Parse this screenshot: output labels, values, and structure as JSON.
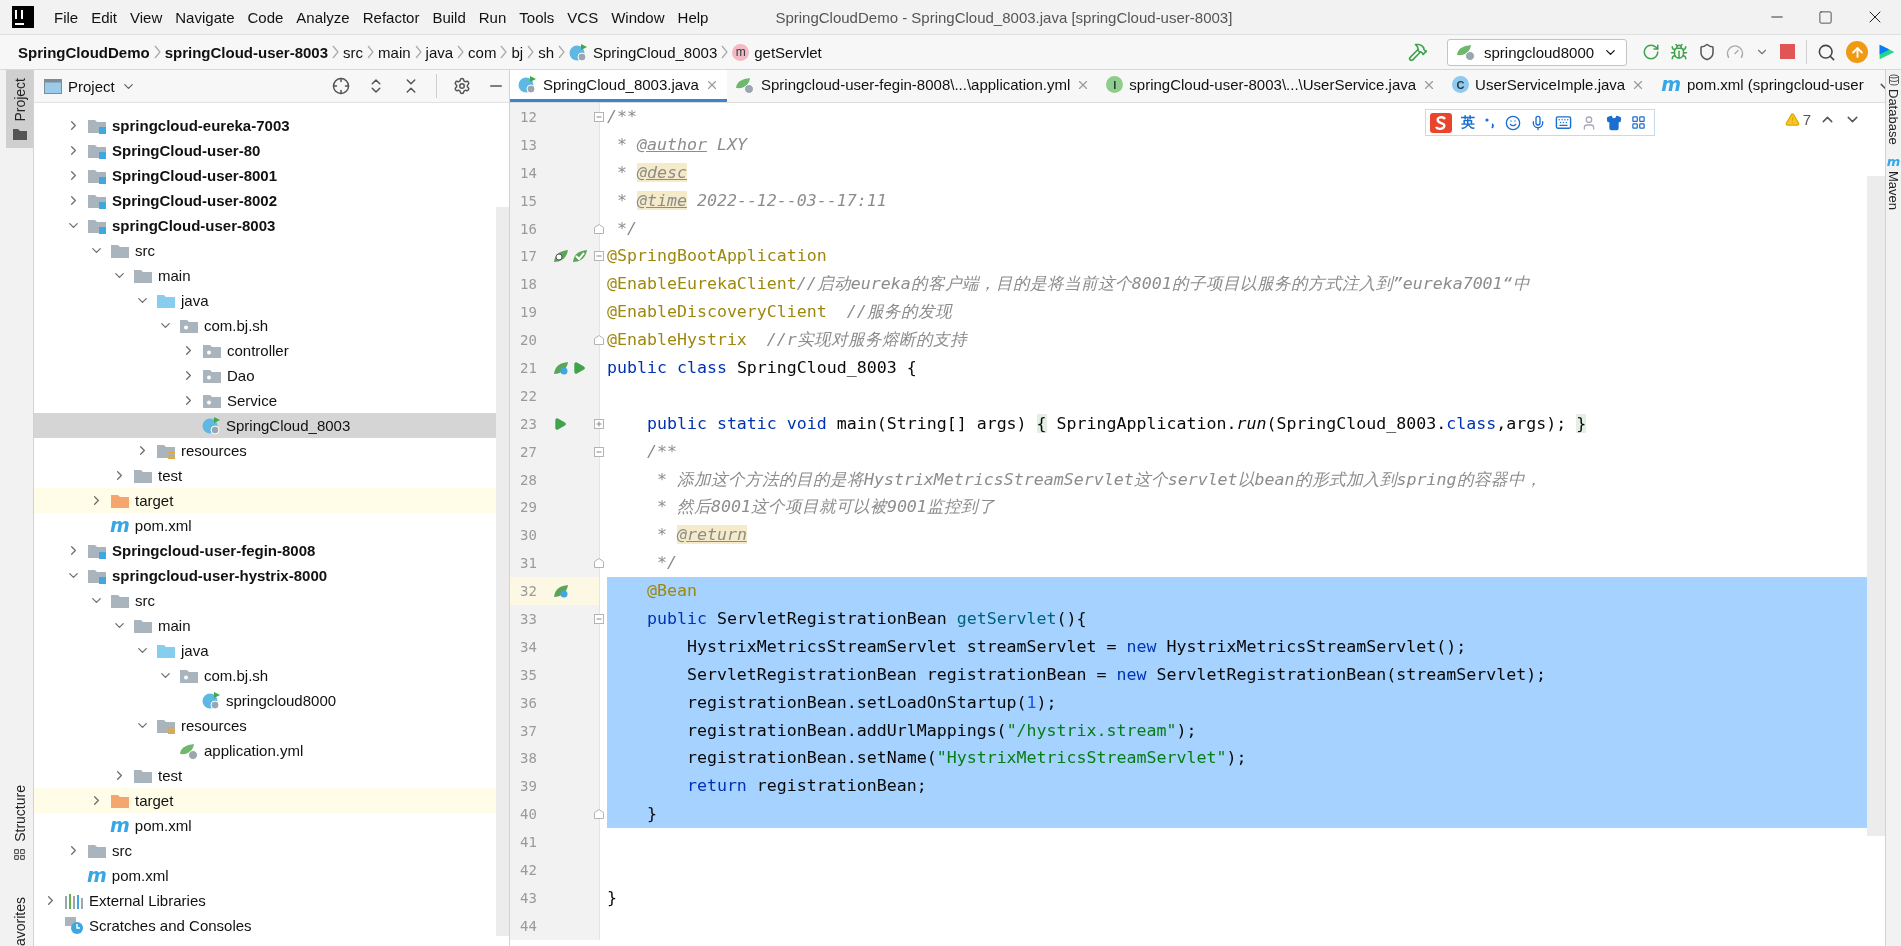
{
  "menu_bar": {
    "items": [
      "File",
      "Edit",
      "View",
      "Navigate",
      "Code",
      "Analyze",
      "Refactor",
      "Build",
      "Run",
      "Tools",
      "VCS",
      "Window",
      "Help"
    ],
    "title": "SpringCloudDemo - SpringCloud_8003.java [springCloud-user-8003]"
  },
  "breadcrumbs": [
    {
      "label": "SpringCloudDemo",
      "kind": "project"
    },
    {
      "label": "springCloud-user-8003",
      "kind": "module"
    },
    {
      "label": "src",
      "kind": "dir"
    },
    {
      "label": "main",
      "kind": "dir"
    },
    {
      "label": "java",
      "kind": "dir"
    },
    {
      "label": "com",
      "kind": "dir"
    },
    {
      "label": "bj",
      "kind": "dir"
    },
    {
      "label": "sh",
      "kind": "dir"
    },
    {
      "label": "SpringCloud_8003",
      "kind": "class"
    },
    {
      "label": "getServlet",
      "kind": "method",
      "badge": "m"
    }
  ],
  "toolbar": {
    "run_configuration": "springcloud8000"
  },
  "left_tool_tabs": [
    {
      "label": "Project",
      "selected": true
    },
    {
      "label": "Structure",
      "selected": false
    },
    {
      "label": "avorites",
      "selected": false
    }
  ],
  "project_panel": {
    "title": "Project",
    "items": [
      {
        "label": "springcloud-eureka-7003",
        "kind": "module",
        "expanded": false,
        "selected": false
      },
      {
        "label": "SpringCloud-user-80",
        "kind": "module",
        "expanded": false,
        "selected": false
      },
      {
        "label": "SpringCloud-user-8001",
        "kind": "module",
        "expanded": false,
        "selected": false
      },
      {
        "label": "SpringCloud-user-8002",
        "kind": "module",
        "expanded": false,
        "selected": false
      },
      {
        "label": "springCloud-user-8003",
        "kind": "module",
        "expanded": true,
        "selected": false,
        "children": [
          {
            "label": "src",
            "kind": "folder",
            "expanded": true,
            "selected": false,
            "children": [
              {
                "label": "main",
                "kind": "folder",
                "expanded": true,
                "selected": false,
                "children": [
                  {
                    "label": "java",
                    "kind": "source",
                    "expanded": true,
                    "selected": false,
                    "children": [
                      {
                        "label": "com.bj.sh",
                        "kind": "package",
                        "expanded": true,
                        "selected": false,
                        "children": [
                          {
                            "label": "controller",
                            "kind": "package",
                            "expanded": false,
                            "selected": false
                          },
                          {
                            "label": "Dao",
                            "kind": "package",
                            "expanded": false,
                            "selected": false
                          },
                          {
                            "label": "Service",
                            "kind": "package",
                            "expanded": false,
                            "selected": false
                          },
                          {
                            "label": "SpringCloud_8003",
                            "kind": "spring-class",
                            "selected": true
                          }
                        ]
                      }
                    ]
                  },
                  {
                    "label": "resources",
                    "kind": "resources",
                    "expanded": false,
                    "selected": false
                  }
                ]
              },
              {
                "label": "test",
                "kind": "folder",
                "expanded": false,
                "selected": false
              }
            ]
          },
          {
            "label": "target",
            "kind": "excluded",
            "expanded": false,
            "selected": false
          },
          {
            "label": "pom.xml",
            "kind": "maven",
            "badge": "m",
            "selected": false
          }
        ]
      },
      {
        "label": "Springcloud-user-fegin-8008",
        "kind": "module",
        "expanded": false,
        "selected": false
      },
      {
        "label": "springcloud-user-hystrix-8000",
        "kind": "module",
        "expanded": true,
        "selected": false,
        "children": [
          {
            "label": "src",
            "kind": "folder",
            "expanded": true,
            "selected": false,
            "children": [
              {
                "label": "main",
                "kind": "folder",
                "expanded": true,
                "selected": false,
                "children": [
                  {
                    "label": "java",
                    "kind": "source",
                    "expanded": true,
                    "selected": false,
                    "children": [
                      {
                        "label": "com.bj.sh",
                        "kind": "package",
                        "expanded": true,
                        "selected": false,
                        "children": [
                          {
                            "label": "springcloud8000",
                            "kind": "spring-class",
                            "selected": false
                          }
                        ]
                      }
                    ]
                  },
                  {
                    "label": "resources",
                    "kind": "resources",
                    "expanded": true,
                    "selected": false,
                    "children": [
                      {
                        "label": "application.yml",
                        "kind": "yml",
                        "selected": false
                      }
                    ]
                  }
                ]
              },
              {
                "label": "test",
                "kind": "folder",
                "expanded": false,
                "selected": false
              }
            ]
          },
          {
            "label": "target",
            "kind": "excluded",
            "expanded": false,
            "selected": false
          },
          {
            "label": "pom.xml",
            "kind": "maven",
            "badge": "m",
            "selected": false
          }
        ]
      },
      {
        "label": "src",
        "kind": "folder",
        "expanded": false,
        "selected": false
      },
      {
        "label": "pom.xml",
        "kind": "maven",
        "badge": "m",
        "selected": false
      }
    ],
    "root_items": [
      {
        "label": "External Libraries",
        "kind": "libraries",
        "expanded": false,
        "selected": false
      },
      {
        "label": "Scratches and Consoles",
        "kind": "scratches",
        "selected": false
      }
    ]
  },
  "editor_tabs": [
    {
      "label": "SpringCloud_8003.java",
      "kind": "spring-class",
      "selected": true,
      "closable": true
    },
    {
      "label": "Springcloud-user-fegin-8008\\...\\application.yml",
      "kind": "yml",
      "selected": false,
      "closable": true
    },
    {
      "label": "springCloud-user-8003\\...\\UserService.java",
      "kind": "interface",
      "badge": "I",
      "selected": false,
      "closable": true
    },
    {
      "label": "UserServiceImple.java",
      "kind": "class",
      "badge": "C",
      "selected": false,
      "closable": true
    },
    {
      "label": "pom.xml (springcloud-user",
      "kind": "maven",
      "badge": "m",
      "selected": false,
      "closable": false
    }
  ],
  "ime_toolbar": {
    "language": "英"
  },
  "inspections": {
    "warnings": "7"
  },
  "code_lines": [
    {
      "number": "12",
      "fold_marker": {
        "kind": "start"
      },
      "selected": false,
      "current": false,
      "tokens": [
        {
          "kind": "comment",
          "text": "/**"
        }
      ]
    },
    {
      "number": "13",
      "selected": false,
      "current": false,
      "tokens": [
        {
          "kind": "comment",
          "text": " * "
        },
        {
          "kind": "doctag",
          "text": "@author"
        },
        {
          "kind": "comment",
          "text": " LXY"
        }
      ]
    },
    {
      "number": "14",
      "selected": false,
      "current": false,
      "tokens": [
        {
          "kind": "comment",
          "text": " * "
        },
        {
          "kind": "doctag_marked",
          "text": "@desc"
        }
      ]
    },
    {
      "number": "15",
      "selected": false,
      "current": false,
      "tokens": [
        {
          "kind": "comment",
          "text": " * "
        },
        {
          "kind": "doctag_marked",
          "text": "@time"
        },
        {
          "kind": "comment",
          "text": " 2022--12--03--17:11"
        }
      ]
    },
    {
      "number": "16",
      "fold_marker": {
        "kind": "end"
      },
      "selected": false,
      "current": false,
      "tokens": [
        {
          "kind": "comment",
          "text": " */"
        }
      ]
    },
    {
      "number": "17",
      "fold_marker": {
        "kind": "start"
      },
      "selected": false,
      "current": false,
      "gutter": [
        {
          "kind": "bean-search"
        },
        {
          "kind": "bean-check"
        }
      ],
      "tokens": [
        {
          "kind": "annotation",
          "text": "@SpringBootApplication"
        }
      ]
    },
    {
      "number": "18",
      "selected": false,
      "current": false,
      "tokens": [
        {
          "kind": "annotation",
          "text": "@EnableEurekaClient"
        },
        {
          "kind": "comment",
          "text": "//启动eureka的客户端，目的是将当前这个8001的子项目以服务的方式注入到”eureka7001“中"
        }
      ]
    },
    {
      "number": "19",
      "selected": false,
      "current": false,
      "tokens": [
        {
          "kind": "annotation",
          "text": "@EnableDiscoveryClient"
        },
        {
          "kind": "comment",
          "text": "  //服务的发现"
        }
      ]
    },
    {
      "number": "20",
      "fold_marker": {
        "kind": "end"
      },
      "selected": false,
      "current": false,
      "tokens": [
        {
          "kind": "annotation",
          "text": "@EnableHystrix"
        },
        {
          "kind": "comment",
          "text": "  //r实现对服务熔断的支持"
        }
      ]
    },
    {
      "number": "21",
      "selected": false,
      "current": false,
      "gutter": [
        {
          "kind": "bean"
        },
        {
          "kind": "run"
        }
      ],
      "tokens": [
        {
          "kind": "keyword",
          "text": "public class"
        },
        {
          "kind": "plain",
          "text": " SpringCloud_8003 {"
        }
      ]
    },
    {
      "number": "22",
      "selected": false,
      "current": false
    },
    {
      "number": "23",
      "fold_marker": {
        "kind": "collapsed"
      },
      "selected": false,
      "current": false,
      "gutter": [
        {
          "kind": "run"
        }
      ],
      "tokens": [
        {
          "kind": "keyword",
          "text": "    public static void"
        },
        {
          "kind": "plain",
          "text": " main(String[] args) "
        },
        {
          "kind": "folded",
          "text": "{"
        },
        {
          "kind": "plain",
          "text": " SpringApplication."
        },
        {
          "kind": "static_call",
          "text": "run"
        },
        {
          "kind": "plain",
          "text": "(SpringCloud_8003."
        },
        {
          "kind": "keyword",
          "text": "class"
        },
        {
          "kind": "plain",
          "text": ",args); "
        },
        {
          "kind": "folded",
          "text": "}"
        }
      ]
    },
    {
      "number": "27",
      "fold_marker": {
        "kind": "start"
      },
      "selected": false,
      "current": false,
      "tokens": [
        {
          "kind": "comment",
          "text": "    /**"
        }
      ]
    },
    {
      "number": "28",
      "selected": false,
      "current": false,
      "tokens": [
        {
          "kind": "comment",
          "text": "     * 添加这个方法的目的是将HystrixMetricsStreamServlet这个servlet以bean的形式加入到spring的容器中，"
        }
      ]
    },
    {
      "number": "29",
      "selected": false,
      "current": false,
      "tokens": [
        {
          "kind": "comment",
          "text": "     * 然后8001这个项目就可以被9001监控到了"
        }
      ]
    },
    {
      "number": "30",
      "selected": false,
      "current": false,
      "tokens": [
        {
          "kind": "comment",
          "text": "     * "
        },
        {
          "kind": "doctag_marked",
          "text": "@return"
        }
      ]
    },
    {
      "number": "31",
      "fold_marker": {
        "kind": "end"
      },
      "selected": false,
      "current": false,
      "tokens": [
        {
          "kind": "comment",
          "text": "     */"
        }
      ]
    },
    {
      "number": "32",
      "selected": true,
      "current": true,
      "gutter": [
        {
          "kind": "bean"
        }
      ],
      "tokens": [
        {
          "kind": "annotation",
          "text": "    @Bean"
        }
      ]
    },
    {
      "number": "33",
      "fold_marker": {
        "kind": "start"
      },
      "selected": true,
      "current": false,
      "tokens": [
        {
          "kind": "keyword",
          "text": "    public"
        },
        {
          "kind": "plain",
          "text": " ServletRegistrationBean "
        },
        {
          "kind": "method_decl",
          "text": "getServlet"
        },
        {
          "kind": "plain",
          "text": "(){"
        }
      ]
    },
    {
      "number": "34",
      "selected": true,
      "current": false,
      "tokens": [
        {
          "kind": "plain",
          "text": "        HystrixMetricsStreamServlet streamServlet = "
        },
        {
          "kind": "keyword",
          "text": "new"
        },
        {
          "kind": "plain",
          "text": " HystrixMetricsStreamServlet();"
        }
      ]
    },
    {
      "number": "35",
      "selected": true,
      "current": false,
      "tokens": [
        {
          "kind": "plain",
          "text": "        ServletRegistrationBean registrationBean = "
        },
        {
          "kind": "keyword",
          "text": "new"
        },
        {
          "kind": "plain",
          "text": " ServletRegistrationBean(streamServlet);"
        }
      ]
    },
    {
      "number": "36",
      "selected": true,
      "current": false,
      "tokens": [
        {
          "kind": "plain",
          "text": "        registrationBean.setLoadOnStartup("
        },
        {
          "kind": "number",
          "text": "1"
        },
        {
          "kind": "plain",
          "text": ");"
        }
      ]
    },
    {
      "number": "37",
      "selected": true,
      "current": false,
      "tokens": [
        {
          "kind": "plain",
          "text": "        registrationBean.addUrlMappings("
        },
        {
          "kind": "string",
          "text": "\"/hystrix.stream\""
        },
        {
          "kind": "plain",
          "text": ");"
        }
      ]
    },
    {
      "number": "38",
      "selected": true,
      "current": false,
      "tokens": [
        {
          "kind": "plain",
          "text": "        registrationBean.setName("
        },
        {
          "kind": "string",
          "text": "\"HystrixMetricsStreamServlet\""
        },
        {
          "kind": "plain",
          "text": ");"
        }
      ]
    },
    {
      "number": "39",
      "selected": true,
      "current": false,
      "tokens": [
        {
          "kind": "keyword",
          "text": "        return"
        },
        {
          "kind": "plain",
          "text": " registrationBean;"
        }
      ]
    },
    {
      "number": "40",
      "fold_marker": {
        "kind": "end"
      },
      "selected": true,
      "current": false,
      "tokens": [
        {
          "kind": "plain",
          "text": "    }"
        }
      ]
    },
    {
      "number": "41",
      "selected": false,
      "current": false
    },
    {
      "number": "42",
      "selected": false,
      "current": false
    },
    {
      "number": "43",
      "selected": false,
      "current": false,
      "tokens": [
        {
          "kind": "plain",
          "text": "}"
        }
      ]
    },
    {
      "number": "44",
      "selected": false,
      "current": false
    }
  ],
  "right_tool_tabs": [
    {
      "label": "Database"
    },
    {
      "label": "Maven",
      "badge": "m"
    }
  ]
}
